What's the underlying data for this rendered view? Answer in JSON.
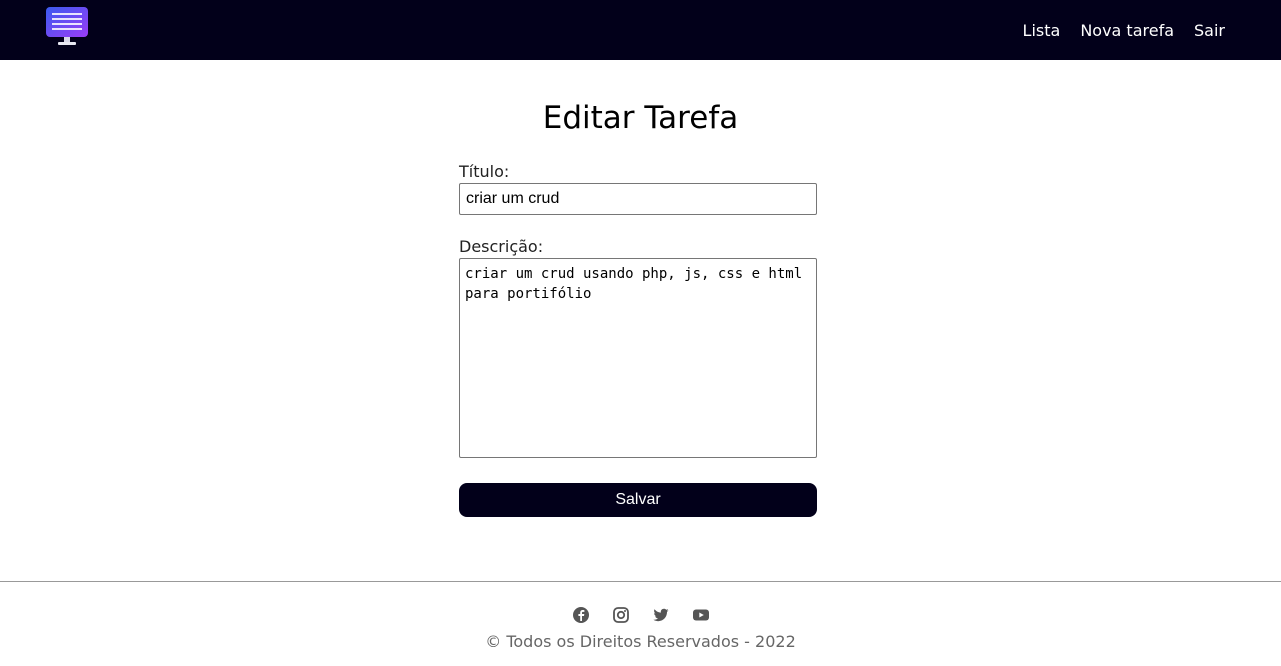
{
  "nav": {
    "logo_icon": "monitor-list-icon",
    "links": [
      "Lista",
      "Nova tarefa",
      "Sair"
    ]
  },
  "page": {
    "title": "Editar Tarefa"
  },
  "form": {
    "title_label": "Título:",
    "title_value": "criar um crud",
    "description_label": "Descrição:",
    "description_value": "criar um crud usando php, js, css e html para portifólio",
    "save_label": "Salvar"
  },
  "footer": {
    "social_icons": [
      "facebook-icon",
      "instagram-icon",
      "twitter-icon",
      "youtube-icon"
    ],
    "copyright": "© Todos os Direitos Reservados - 2022"
  },
  "colors": {
    "navbar": "#02001a",
    "button": "#02001a",
    "logo_gradient_start": "#4f46e5",
    "logo_gradient_end": "#8b3cf6"
  }
}
